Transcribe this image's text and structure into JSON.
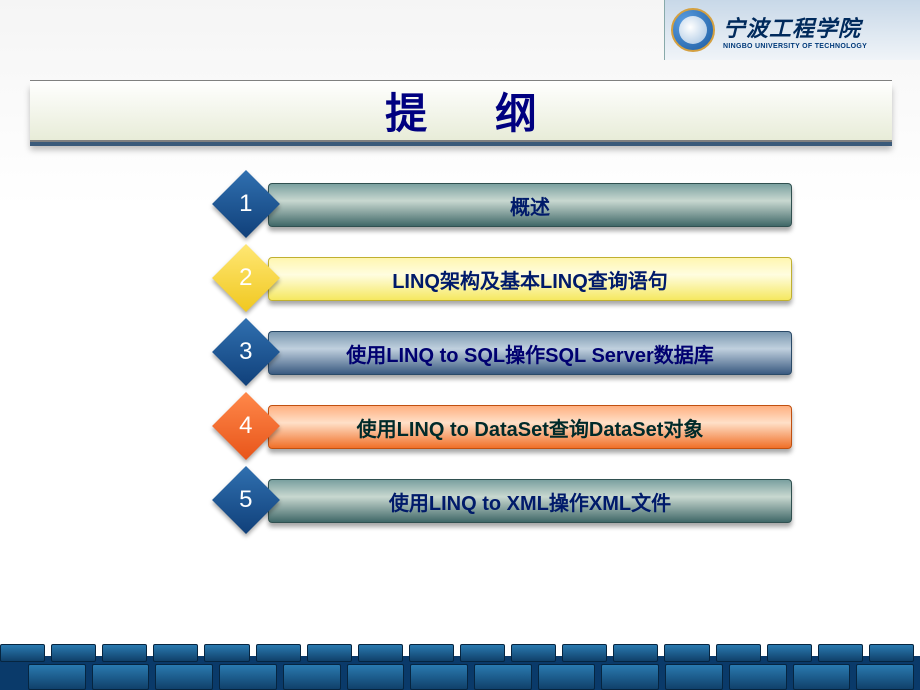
{
  "logo": {
    "name_cn": "宁波工程学院",
    "name_en": "NINGBO UNIVERSITY OF TECHNOLOGY"
  },
  "title": "提 纲",
  "items": [
    {
      "num": "1",
      "text": "概述"
    },
    {
      "num": "2",
      "text": "LINQ架构及基本LINQ查询语句"
    },
    {
      "num": "3",
      "text": "使用LINQ to SQL操作SQL Server数据库"
    },
    {
      "num": "4",
      "text": "使用LINQ to DataSet查询DataSet对象"
    },
    {
      "num": "5",
      "text": "使用LINQ to XML操作XML文件"
    }
  ],
  "colors": {
    "title_text": "#000080",
    "item_text_dark": "#001a6a"
  }
}
